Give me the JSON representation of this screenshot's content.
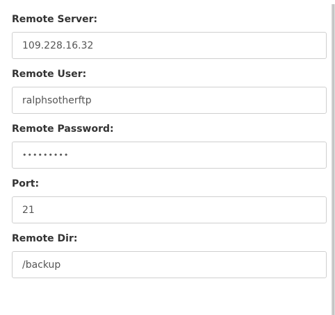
{
  "form": {
    "fields": [
      {
        "label": "Remote Server:",
        "value": "109.228.16.32"
      },
      {
        "label": "Remote User:",
        "value": "ralphsotherftp"
      },
      {
        "label": "Remote Password:",
        "value": "•••••••••"
      },
      {
        "label": "Port:",
        "value": "21"
      },
      {
        "label": "Remote Dir:",
        "value": "/backup"
      }
    ]
  }
}
